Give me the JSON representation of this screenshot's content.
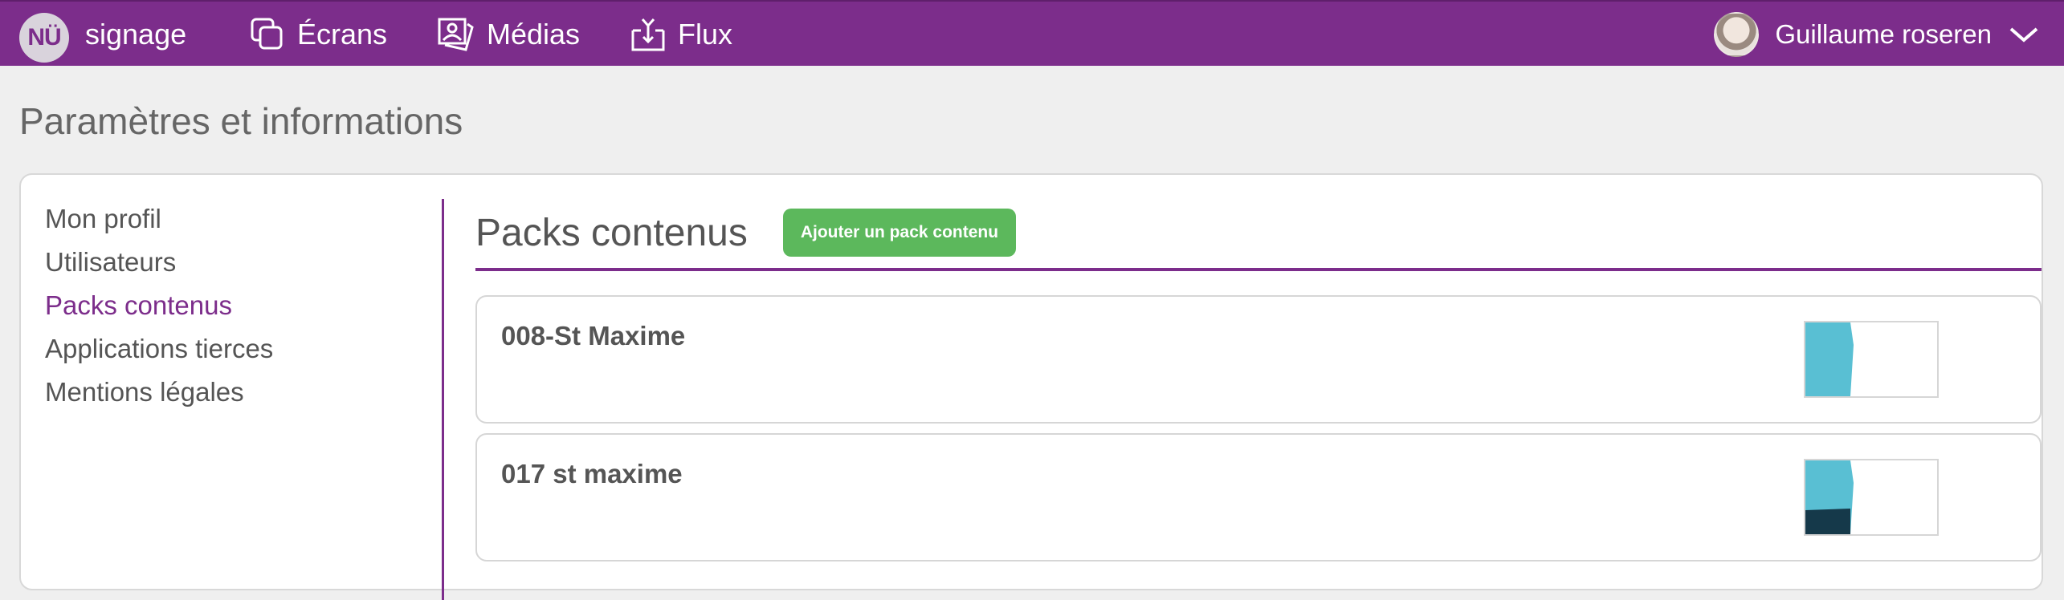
{
  "topbar": {
    "logo_text": "NÜ",
    "brand": "signage",
    "nav": [
      {
        "label": "Écrans",
        "icon": "screens-icon"
      },
      {
        "label": "Médias",
        "icon": "media-icon"
      },
      {
        "label": "Flux",
        "icon": "flux-icon"
      }
    ],
    "user_name": "Guillaume roseren",
    "colors": {
      "bar": "#7c2d8b",
      "text": "#ffffff"
    }
  },
  "page": {
    "title": "Paramètres et informations"
  },
  "sidebar": {
    "items": [
      {
        "label": "Mon profil",
        "active": false
      },
      {
        "label": "Utilisateurs",
        "active": false
      },
      {
        "label": "Packs contenus",
        "active": true
      },
      {
        "label": "Applications tierces",
        "active": false
      },
      {
        "label": "Mentions légales",
        "active": false
      }
    ]
  },
  "section": {
    "title": "Packs contenus",
    "add_button": "Ajouter un pack contenu",
    "accent_color": "#7c2d8b",
    "button_color": "#5cb85c"
  },
  "packs": [
    {
      "name": "008-St Maxime",
      "preview": "cyan-banner"
    },
    {
      "name": "017 st maxime",
      "preview": "cyan-dark-banner"
    }
  ]
}
